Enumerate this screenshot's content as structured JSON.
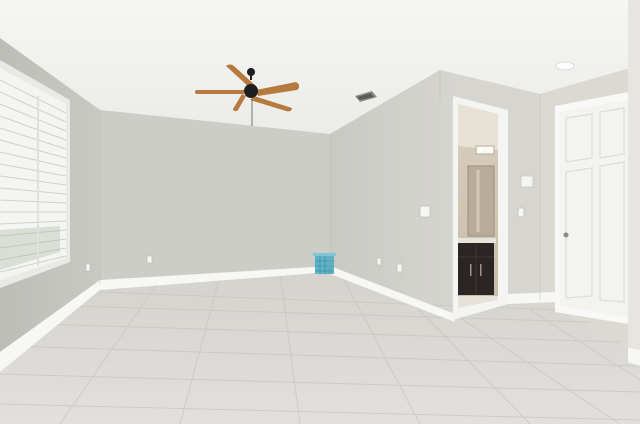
{
  "scene": {
    "kind": "empty-bedroom-photo",
    "colors": {
      "ceiling": "#f2f2f0",
      "wall_back": "#cfcfca",
      "wall_left": "#c4c4bf",
      "wall_right": "#d3d2cd",
      "wall_right_far": "#dcd9d3",
      "floor": "#dcdad6",
      "baseboard": "#f7f7f5",
      "door": "#f3f3f1",
      "fan_blade": "#b77a3e",
      "fan_motor": "#1e1e1e",
      "vanity": "#2b2624",
      "basket": "#5fb3c8",
      "window_blinds": "#f4f4f2"
    },
    "objects": [
      "ceiling-fan",
      "window-with-blinds",
      "hvac-vent",
      "recessed-light",
      "bathroom-doorway",
      "bathroom-vanity",
      "closet-door",
      "blue-basket",
      "tile-floor",
      "baseboards",
      "light-switches",
      "outlets"
    ]
  }
}
